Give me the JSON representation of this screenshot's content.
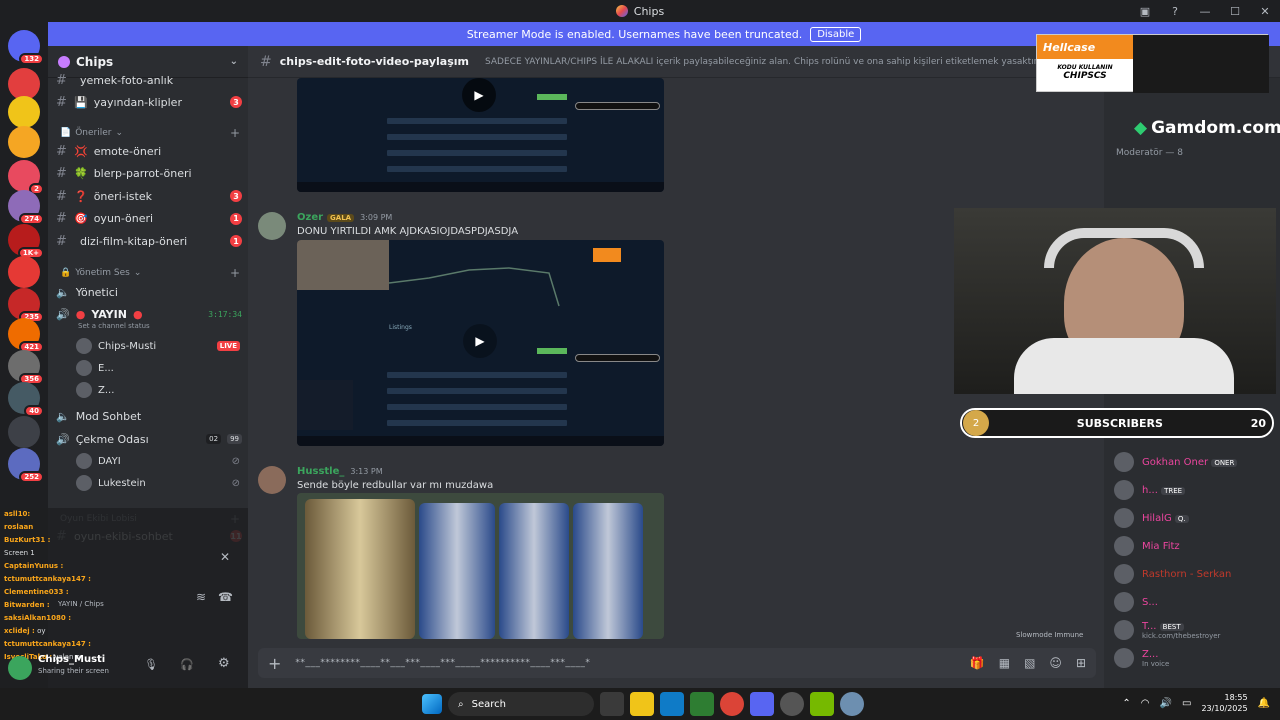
{
  "window": {
    "title": "Chips"
  },
  "banner": {
    "text": "Streamer Mode is enabled. Usernames have been truncated.",
    "button": "Disable"
  },
  "servers": [
    {
      "badge": "132",
      "color": "#5865f2"
    },
    {
      "badge": "",
      "color": "#e23e3e"
    },
    {
      "badge": "",
      "color": "#f0c419"
    },
    {
      "badge": "",
      "color": "#f5a623"
    },
    {
      "badge": "2",
      "color": "#e84a5f"
    },
    {
      "badge": "274",
      "color": "#8e6bb8"
    },
    {
      "badge": "1K+",
      "color": "#b71c1c"
    },
    {
      "badge": "",
      "color": "#e53935"
    },
    {
      "badge": "235",
      "color": "#c62828"
    },
    {
      "badge": "421",
      "color": "#ef6c00"
    },
    {
      "badge": "356",
      "color": "#6d6d6d"
    },
    {
      "badge": "40",
      "color": "#455a64"
    },
    {
      "badge": "",
      "color": "#3d4047"
    },
    {
      "badge": "252",
      "color": "#5c6bc0"
    }
  ],
  "sidebar": {
    "server_name": "Chips",
    "top_channels": [
      {
        "icon": "",
        "label": "yemek-foto-anlık",
        "badge": ""
      },
      {
        "icon": "💾",
        "label": "yayından-klipler",
        "badge": "3"
      }
    ],
    "cat_oneriler": "Öneriler",
    "oneri_channels": [
      {
        "icon": "💢",
        "label": "emote-öneri",
        "badge": ""
      },
      {
        "icon": "🍀",
        "label": "blerp-parrot-öneri",
        "badge": ""
      },
      {
        "icon": "❓",
        "label": "öneri-istek",
        "badge": "3"
      },
      {
        "icon": "🎯",
        "label": "oyun-öneri",
        "badge": "1"
      },
      {
        "icon": "",
        "label": "dizi-film-kitap-öneri",
        "badge": "1"
      }
    ],
    "cat_yonetim": "Yönetim Ses",
    "voice_yonetici": "Yönetici",
    "voice_yayin": "YAYIN",
    "voice_yayin_time": "3:17:34",
    "channel_status": "Set a channel status",
    "voice_users": [
      {
        "name": "Chips-Musti",
        "live": "LIVE"
      },
      {
        "name": "E...",
        "live": ""
      },
      {
        "name": "Z...",
        "live": ""
      }
    ],
    "voice_mod": "Mod Sohbet",
    "voice_cekme": "Çekme Odası",
    "cekme_counts": [
      "02",
      "99"
    ],
    "cekme_users": [
      "DAYI",
      "Lukestein"
    ],
    "cat_oyun": "Oyun Ekibi Lobisi",
    "oyun_channel": "oyun-ekibi-sohbet",
    "oyun_badge": "11"
  },
  "overlay_chat": [
    {
      "user": "asll10:",
      "text": ""
    },
    {
      "user": "roslaan",
      "text": ""
    },
    {
      "user": "BuzKurt31 :",
      "text": ""
    },
    {
      "user": "",
      "text": "Screen 1"
    },
    {
      "user": "CaptainYunus :",
      "text": ""
    },
    {
      "user": "tctumuttcankaya147 :",
      "text": ""
    },
    {
      "user": "Clementine033 :",
      "text": ""
    },
    {
      "user": "Bitwarden :",
      "text": ""
    },
    {
      "user": "saksiAlkan1080 :",
      "text": ""
    },
    {
      "user": "xclidej :",
      "text": "oy"
    },
    {
      "user": "tctumuttcankaya147 :",
      "text": ""
    },
    {
      "user": "IsvecliTako :",
      "text": "yalan o"
    }
  ],
  "userpanel": {
    "name": "Chips_Musti",
    "status": "Sharing their screen",
    "voice_status": "YAYIN",
    "voice_path": "/ Chips"
  },
  "chat": {
    "channel": "chips-edit-foto-video-paylaşım",
    "topic": "SADECE YAYINLAR/CHIPS İLE ALAKALI içerik paylaşabileceğiniz alan. Chips rolünü ve ona sahip kişileri etiketlemek yasaktır.",
    "messages": [
      {
        "name": "Ozer",
        "tag": "GALA",
        "time": "3:09 PM",
        "text": "DONU YIRTILDI AMK AJDKASIOJDASPDJASDJA",
        "name_color": "#3ba55d"
      },
      {
        "name": "Husstle_",
        "tag": "",
        "time": "3:13 PM",
        "text": "Sende böyle redbullar var mı muzdawa",
        "name_color": "#3ba55d"
      }
    ],
    "embed_listings": "Listings",
    "embed_subscribers": "SUBSCRIBERS",
    "composer_text": "**___********____**___***____***_____**********____***____*",
    "slowmode": "Slowmode Immune"
  },
  "members": {
    "group": "Moderatör",
    "group_count": "8",
    "list": [
      {
        "name": "Gokhan Oner",
        "badge": "ONER",
        "color": "#eb459e"
      },
      {
        "name": "h...",
        "badge": "TREE",
        "color": "#eb459e"
      },
      {
        "name": "HilalG",
        "badge": "Q.",
        "color": "#eb459e"
      },
      {
        "name": "Mia Fitz",
        "badge": "",
        "color": "#eb459e"
      },
      {
        "name": "Rasthorn - Serkan",
        "badge": "",
        "color": "#c0392b"
      },
      {
        "name": "S...",
        "badge": "",
        "color": "#eb459e"
      },
      {
        "name": "T...",
        "badge": "BEST",
        "color": "#eb459e",
        "sub": "kick.com/thebestroyer"
      },
      {
        "name": "Z...",
        "badge": "",
        "color": "#eb459e",
        "sub": "In voice"
      }
    ]
  },
  "hellcase": {
    "brand": "Hellcase",
    "line1": "KODU KULLANIN",
    "code": "CHIPSCS"
  },
  "gamdom": "Gamdom.com",
  "subscribers": {
    "label": "SUBSCRIBERS",
    "left": "2",
    "count": "20"
  },
  "taskbar": {
    "search": "Search",
    "time": "18:55",
    "date": "23/10/2025"
  }
}
